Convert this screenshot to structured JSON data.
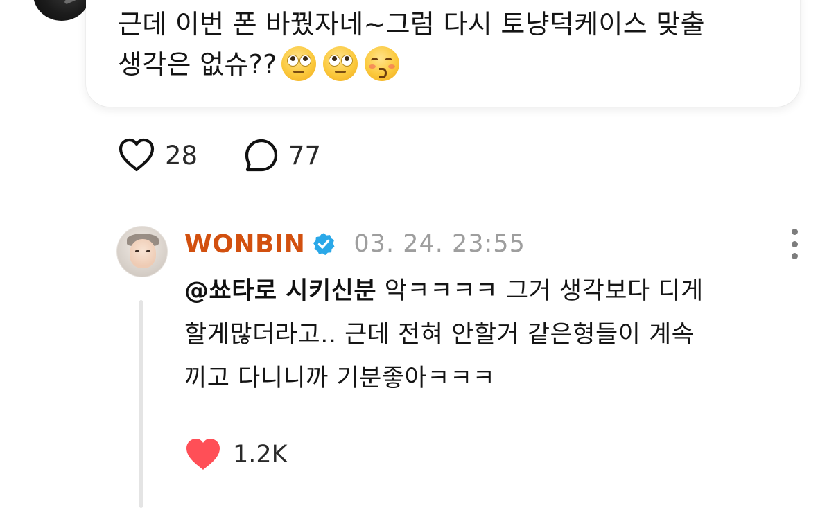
{
  "post": {
    "text_line1": "근데 이번 폰 바꿨자네~그럼 다시 토냥덕케이스 맞출",
    "text_line2": "생각은 없슈??",
    "emojis": [
      "face-with-rolling-eyes-emoji",
      "face-with-rolling-eyes-emoji",
      "kissing-face-with-closed-eyes-emoji"
    ],
    "likes": "28",
    "replies": "77"
  },
  "reply": {
    "author": "WONBIN",
    "verified": true,
    "timestamp": "03. 24. 23:55",
    "mention": "@쑈타로 시키신분",
    "text_line1_rest": " 악ㅋㅋㅋㅋ 그거 생각보다 디게",
    "text_line2": "할게많더라고.. 근데  전혀 안할거 같은형들이 계속",
    "text_line3": "끼고 다니니까 기분좋아ㅋㅋㅋ",
    "likes": "1.2K",
    "liked": true
  },
  "colors": {
    "author_name": "#d2500f",
    "verified_badge": "#2aa8e8",
    "liked_heart": "#ff4f57",
    "timestamp": "#9e9e9e",
    "thread_line": "#e4e4e4"
  }
}
